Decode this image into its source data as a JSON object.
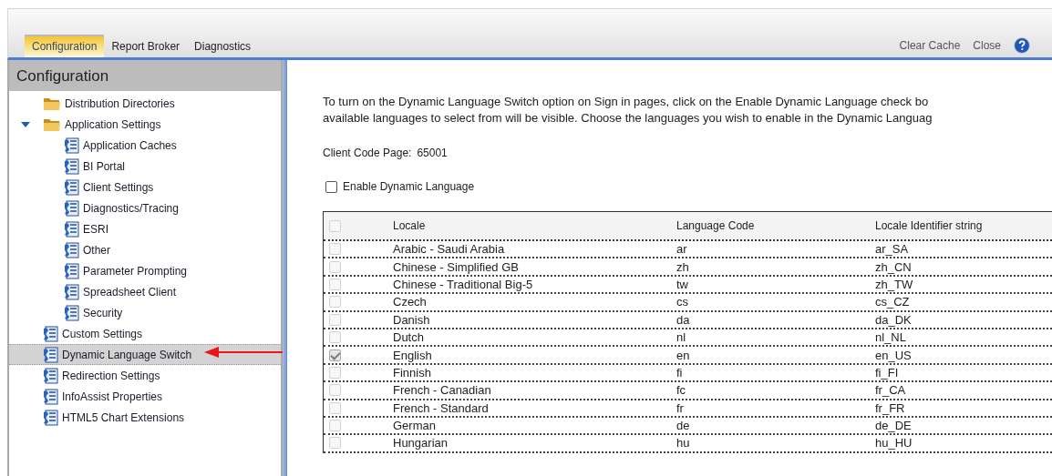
{
  "tabs": [
    {
      "label": "Configuration",
      "selected": true
    },
    {
      "label": "Report Broker",
      "selected": false
    },
    {
      "label": "Diagnostics",
      "selected": false
    }
  ],
  "toolbar_actions": [
    "Clear Cache",
    "Close"
  ],
  "sidebar": {
    "title": "Configuration",
    "items": [
      {
        "label": "Distribution Directories",
        "kind": "folder",
        "selected": false
      },
      {
        "label": "Application Settings",
        "kind": "folder",
        "selected": false,
        "expanded": true,
        "children": [
          {
            "label": "Application Caches",
            "kind": "setting",
            "selected": false
          },
          {
            "label": "BI Portal",
            "kind": "setting",
            "selected": false
          },
          {
            "label": "Client Settings",
            "kind": "setting",
            "selected": false
          },
          {
            "label": "Diagnostics/Tracing",
            "kind": "setting",
            "selected": false
          },
          {
            "label": "ESRI",
            "kind": "setting",
            "selected": false
          },
          {
            "label": "Other",
            "kind": "setting",
            "selected": false
          },
          {
            "label": "Parameter Prompting",
            "kind": "setting",
            "selected": false
          },
          {
            "label": "Spreadsheet Client",
            "kind": "setting",
            "selected": false
          },
          {
            "label": "Security",
            "kind": "setting",
            "selected": false
          }
        ]
      },
      {
        "label": "Custom Settings",
        "kind": "setting",
        "selected": false
      },
      {
        "label": "Dynamic Language Switch",
        "kind": "setting",
        "selected": true
      },
      {
        "label": "Redirection Settings",
        "kind": "setting",
        "selected": false
      },
      {
        "label": "InfoAssist Properties",
        "kind": "setting",
        "selected": false
      },
      {
        "label": "HTML5 Chart Extensions",
        "kind": "setting",
        "selected": false
      }
    ]
  },
  "content": {
    "intro_lines": [
      "To turn on the Dynamic Language Switch option on Sign in pages, click on the Enable Dynamic Language check bo",
      "available languages to select from will be visible. Choose the languages you wish to enable in the Dynamic Languag"
    ],
    "client_code_page_label": "Client Code Page:",
    "client_code_page_value": "65001",
    "enable_dynamic_language": {
      "label": "Enable Dynamic Language",
      "checked": false
    },
    "table": {
      "header_checkbox": {
        "checked": false,
        "disabled": true
      },
      "columns": [
        "Locale",
        "Language Code",
        "Locale Identifier string"
      ],
      "rows": [
        {
          "locale": "Arabic - Saudi Arabia",
          "code": "ar",
          "identifier": "ar_SA",
          "checked": false,
          "disabled": true
        },
        {
          "locale": "Chinese - Simplified GB",
          "code": "zh",
          "identifier": "zh_CN",
          "checked": false,
          "disabled": true
        },
        {
          "locale": "Chinese - Traditional Big-5",
          "code": "tw",
          "identifier": "zh_TW",
          "checked": false,
          "disabled": true
        },
        {
          "locale": "Czech",
          "code": "cs",
          "identifier": "cs_CZ",
          "checked": false,
          "disabled": true
        },
        {
          "locale": "Danish",
          "code": "da",
          "identifier": "da_DK",
          "checked": false,
          "disabled": true
        },
        {
          "locale": "Dutch",
          "code": "nl",
          "identifier": "nl_NL",
          "checked": false,
          "disabled": true
        },
        {
          "locale": "English",
          "code": "en",
          "identifier": "en_US",
          "checked": true,
          "disabled": true
        },
        {
          "locale": "Finnish",
          "code": "fi",
          "identifier": "fi_FI",
          "checked": false,
          "disabled": true
        },
        {
          "locale": "French - Canadian",
          "code": "fc",
          "identifier": "fr_CA",
          "checked": false,
          "disabled": true
        },
        {
          "locale": "French - Standard",
          "code": "fr",
          "identifier": "fr_FR",
          "checked": false,
          "disabled": true
        },
        {
          "locale": "German",
          "code": "de",
          "identifier": "de_DE",
          "checked": false,
          "disabled": true
        },
        {
          "locale": "Hungarian",
          "code": "hu",
          "identifier": "hu_HU",
          "checked": false,
          "disabled": true
        }
      ]
    }
  }
}
